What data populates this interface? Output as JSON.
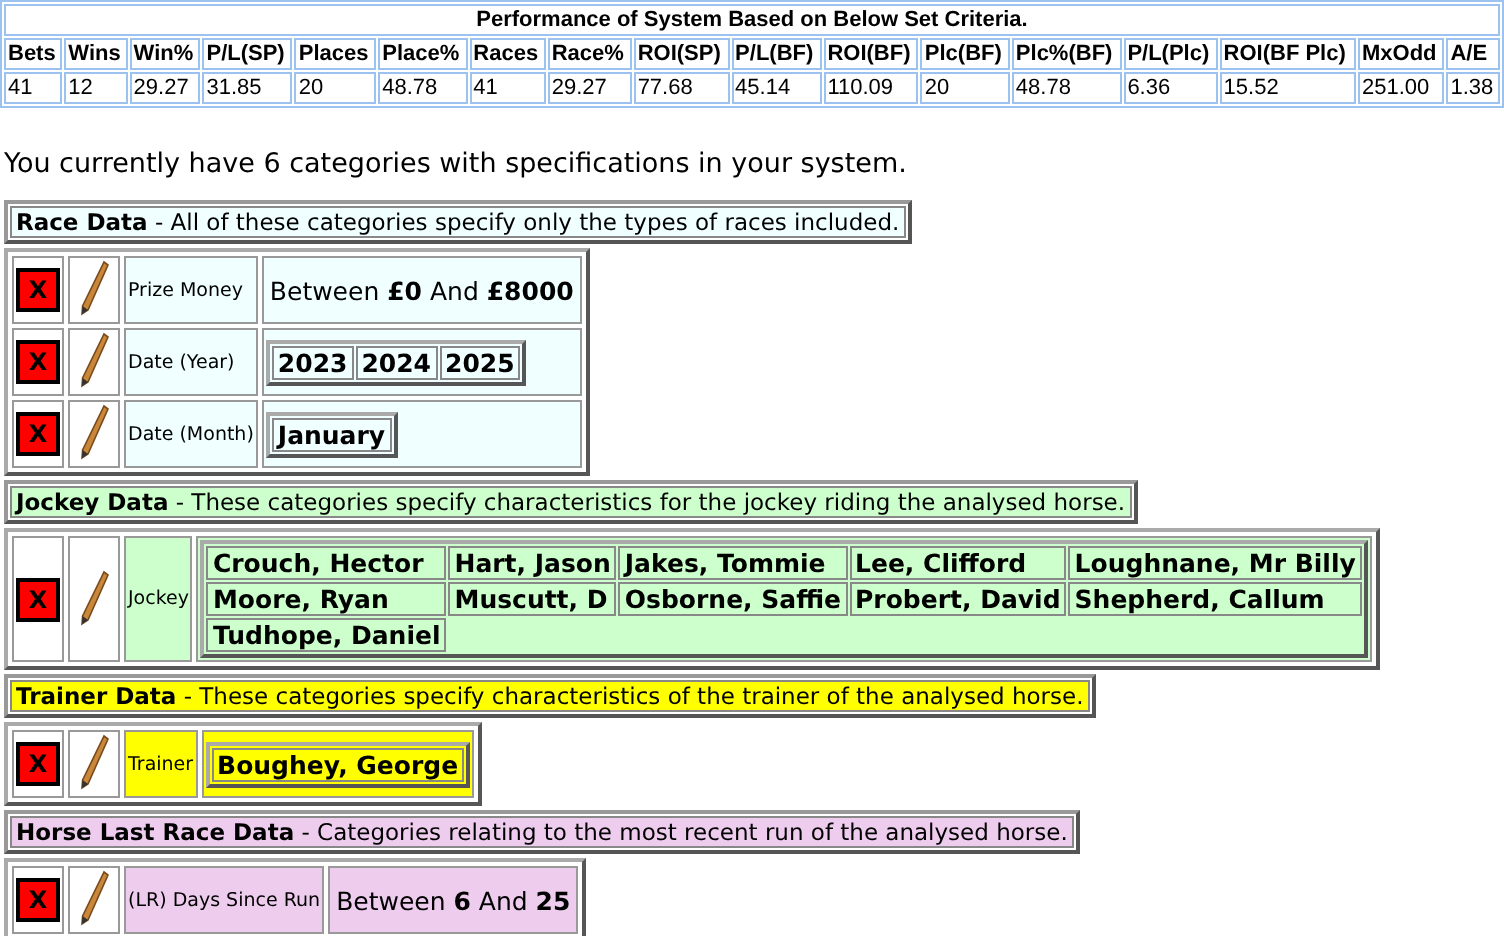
{
  "performance": {
    "title": "Performance of System Based on Below Set Criteria.",
    "columns": [
      "Bets",
      "Wins",
      "Win%",
      "P/L(SP)",
      "Places",
      "Place%",
      "Races",
      "Race%",
      "ROI(SP)",
      "P/L(BF)",
      "ROI(BF)",
      "Plc(BF)",
      "Plc%(BF)",
      "P/L(Plc)",
      "ROI(BF Plc)",
      "MxOdd",
      "A/E"
    ],
    "values": [
      "41",
      "12",
      "29.27",
      "31.85",
      "20",
      "48.78",
      "41",
      "29.27",
      "77.68",
      "45.14",
      "110.09",
      "20",
      "48.78",
      "6.36",
      "15.52",
      "251.00",
      "1.38"
    ]
  },
  "summary": "You currently have 6 categories with specifications in your system.",
  "sections": [
    {
      "title": "Race Data",
      "description": " - All of these categories specify only the types of races included.",
      "color": "#f0ffff",
      "categories": [
        {
          "delete_label": "X",
          "name": "Prize Money",
          "kind": "range",
          "text": "Between **£0** And **£8000**"
        },
        {
          "delete_label": "X",
          "name": "Date (Year)",
          "kind": "chips",
          "chips": [
            "2023",
            "2024",
            "2025"
          ]
        },
        {
          "delete_label": "X",
          "name": "Date (Month)",
          "kind": "chips",
          "chips": [
            "January"
          ]
        }
      ]
    },
    {
      "title": "Jockey Data",
      "description": " - These categories specify characteristics for the jockey riding the analysed horse.",
      "color": "#ccffcc",
      "categories": [
        {
          "delete_label": "X",
          "name": "Jockey",
          "kind": "chips",
          "chips": [
            "Crouch, Hector",
            "Hart, Jason",
            "Jakes, Tommie",
            "Lee, Clifford",
            "Loughnane, Mr Billy",
            "Moore, Ryan",
            "Muscutt, D",
            "Osborne, Saffie",
            "Probert, David",
            "Shepherd, Callum",
            "Tudhope, Daniel"
          ]
        }
      ]
    },
    {
      "title": "Trainer Data",
      "description": " - These categories specify characteristics of the trainer of the analysed horse.",
      "color": "#ffff00",
      "categories": [
        {
          "delete_label": "X",
          "name": "Trainer",
          "kind": "chips",
          "chips": [
            "Boughey, George"
          ]
        }
      ]
    },
    {
      "title": "Horse Last Race Data",
      "description": " - Categories relating to the most recent run of the analysed horse.",
      "color": "#eeccee",
      "categories": [
        {
          "delete_label": "X",
          "name": "(LR) Days Since Run",
          "kind": "range",
          "text": "Between **6** And **25**"
        }
      ]
    }
  ]
}
